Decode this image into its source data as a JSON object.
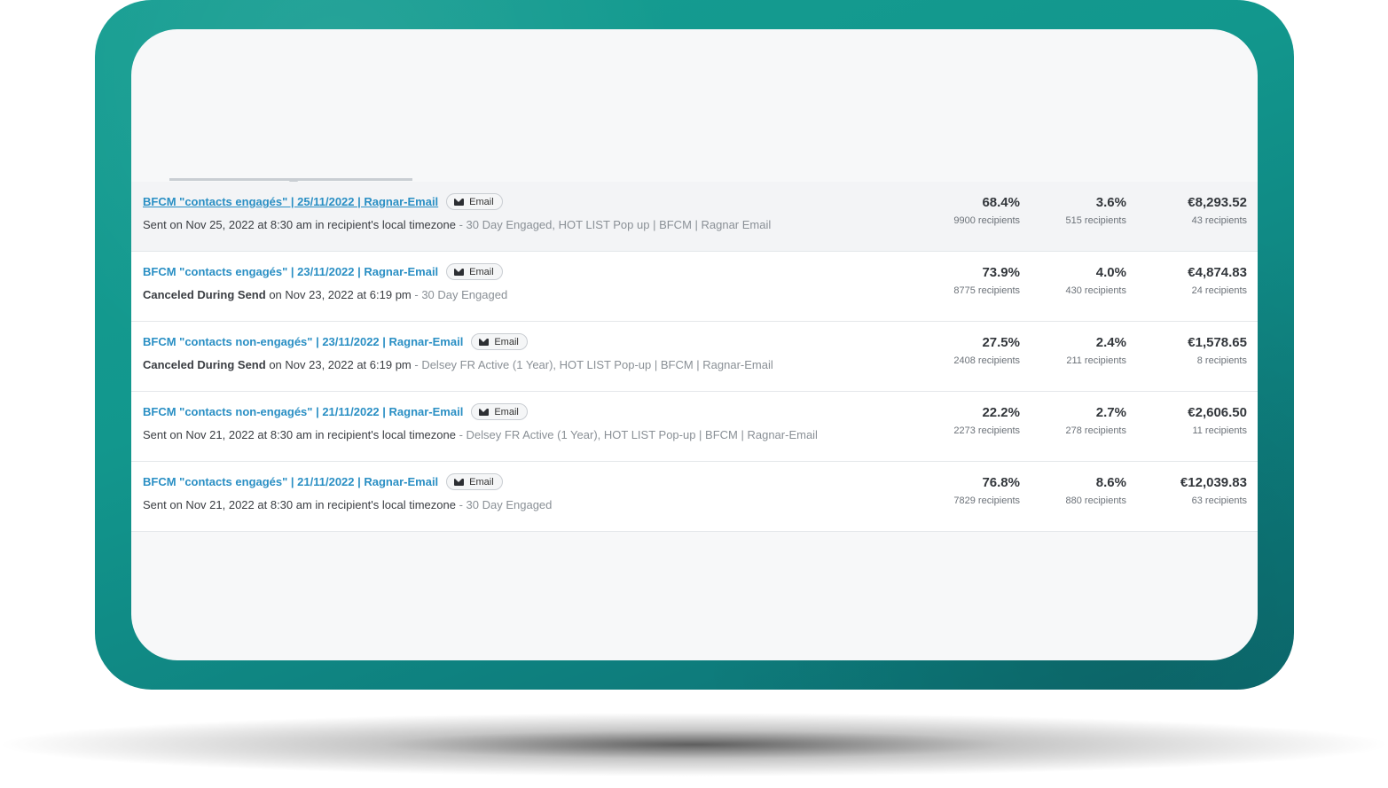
{
  "badge_label": "Email",
  "campaigns": [
    {
      "title": "BFCM \"contacts engagés\" | 25/11/2022 | Ragnar-Email",
      "status": "Sent",
      "detail": " on Nov 25, 2022 at 8:30 am in recipient's local timezone",
      "lists": " - 30 Day Engaged, HOT LIST Pop up | BFCM | Ragnar Email",
      "open_rate": "68.4%",
      "open_recipients": "9900 recipients",
      "click_rate": "3.6%",
      "click_recipients": "515 recipients",
      "revenue": "€8,293.52",
      "revenue_recipients": "43 recipients"
    },
    {
      "title": "BFCM \"contacts engagés\" | 23/11/2022 | Ragnar-Email",
      "status": "Canceled During Send",
      "detail": " on Nov 23, 2022 at 6:19 pm",
      "lists": " - 30 Day Engaged",
      "open_rate": "73.9%",
      "open_recipients": "8775 recipients",
      "click_rate": "4.0%",
      "click_recipients": "430 recipients",
      "revenue": "€4,874.83",
      "revenue_recipients": "24 recipients"
    },
    {
      "title": "BFCM \"contacts non-engagés\" | 23/11/2022 | Ragnar-Email",
      "status": "Canceled During Send",
      "detail": " on Nov 23, 2022 at 6:19 pm",
      "lists": " - Delsey FR Active (1 Year), HOT LIST Pop-up | BFCM | Ragnar-Email",
      "open_rate": "27.5%",
      "open_recipients": "2408 recipients",
      "click_rate": "2.4%",
      "click_recipients": "211 recipients",
      "revenue": "€1,578.65",
      "revenue_recipients": "8 recipients"
    },
    {
      "title": "BFCM \"contacts non-engagés\" | 21/11/2022 | Ragnar-Email",
      "status": "Sent",
      "detail": " on Nov 21, 2022 at 8:30 am in recipient's local timezone",
      "lists": " - Delsey FR Active (1 Year), HOT LIST Pop-up | BFCM | Ragnar-Email",
      "open_rate": "22.2%",
      "open_recipients": "2273 recipients",
      "click_rate": "2.7%",
      "click_recipients": "278 recipients",
      "revenue": "€2,606.50",
      "revenue_recipients": "11 recipients"
    },
    {
      "title": "BFCM \"contacts engagés\" | 21/11/2022 | Ragnar-Email",
      "status": "Sent",
      "detail": " on Nov 21, 2022 at 8:30 am in recipient's local timezone",
      "lists": " - 30 Day Engaged",
      "open_rate": "76.8%",
      "open_recipients": "7829 recipients",
      "click_rate": "8.6%",
      "click_recipients": "880 recipients",
      "revenue": "€12,039.83",
      "revenue_recipients": "63 recipients"
    }
  ],
  "colors": {
    "frame": "#12978d",
    "link": "#2a8fc4",
    "screen_bg": "#f7f8f9"
  }
}
